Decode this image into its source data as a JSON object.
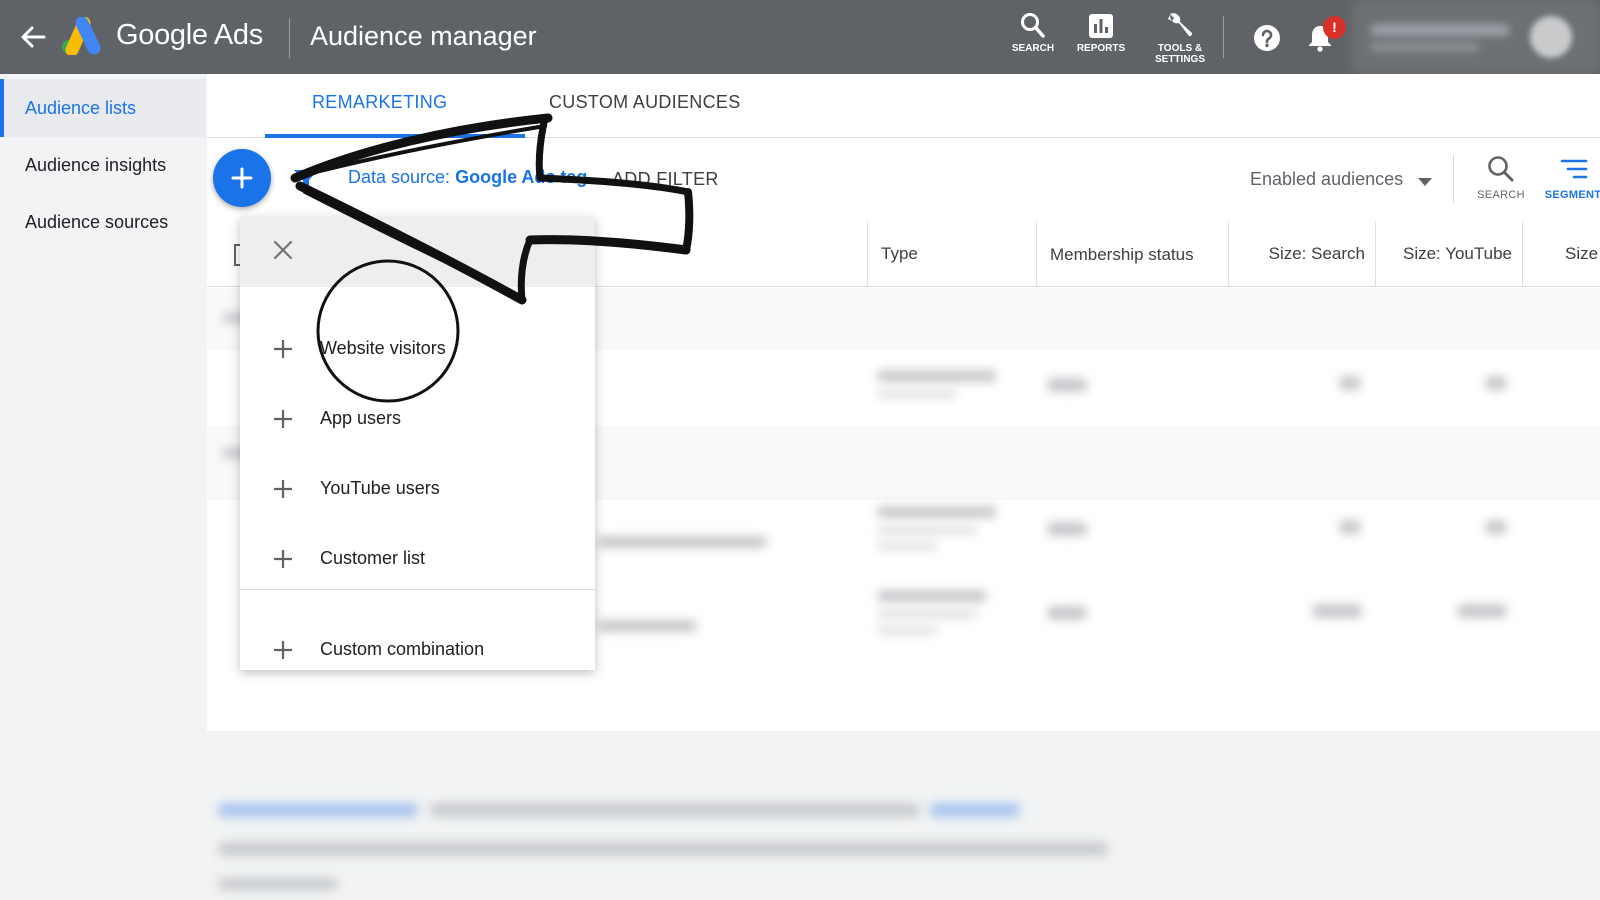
{
  "header": {
    "brand": "Google Ads",
    "page_title": "Audience manager",
    "search_label": "SEARCH",
    "reports_label": "REPORTS",
    "tools_label_line1": "TOOLS &",
    "tools_label_line2": "SETTINGS",
    "notification_badge": "!"
  },
  "sidebar": {
    "items": [
      {
        "label": "Audience lists"
      },
      {
        "label": "Audience insights"
      },
      {
        "label": "Audience sources"
      }
    ]
  },
  "tabs": [
    {
      "label": "REMARKETING"
    },
    {
      "label": "CUSTOM AUDIENCES"
    }
  ],
  "toolbar": {
    "datasource_label": "Data source:",
    "datasource_value": "Google Ads tag",
    "add_filter": "ADD FILTER",
    "enabled_audiences": "Enabled audiences",
    "search_label": "SEARCH",
    "segment_label": "SEGMENT"
  },
  "table": {
    "columns": [
      "Type",
      "Membership status",
      "Size: Search",
      "Size: YouTube",
      "Size"
    ]
  },
  "menu": {
    "items": [
      {
        "label": "Website visitors"
      },
      {
        "label": "App users"
      },
      {
        "label": "YouTube users"
      },
      {
        "label": "Customer list"
      },
      {
        "label": "Custom combination"
      }
    ]
  },
  "colors": {
    "accent": "#1a73e8",
    "topbar": "#5f6368",
    "badge": "#d93025"
  }
}
